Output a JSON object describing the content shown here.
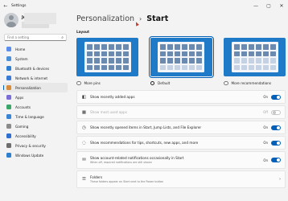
{
  "window": {
    "title": "Settings",
    "back": "←",
    "minimize": "—",
    "maximize": "▢",
    "close": "✕"
  },
  "user": {
    "name": "Jeff"
  },
  "search": {
    "placeholder": "Find a setting",
    "icon": "search-icon"
  },
  "nav": [
    {
      "label": "Home",
      "name": "home",
      "color": "#5b8def"
    },
    {
      "label": "System",
      "name": "system",
      "color": "#4a90d9"
    },
    {
      "label": "Bluetooth & devices",
      "name": "bluetooth",
      "color": "#2f7fd1"
    },
    {
      "label": "Network & internet",
      "name": "network",
      "color": "#3a7bd5"
    },
    {
      "label": "Personalization",
      "name": "personalization",
      "color": "#d98c3a",
      "active": true
    },
    {
      "label": "Apps",
      "name": "apps",
      "color": "#7a6fd8"
    },
    {
      "label": "Accounts",
      "name": "accounts",
      "color": "#3aa66a"
    },
    {
      "label": "Time & language",
      "name": "time-language",
      "color": "#3a84d8"
    },
    {
      "label": "Gaming",
      "name": "gaming",
      "color": "#8a8a8a"
    },
    {
      "label": "Accessibility",
      "name": "accessibility",
      "color": "#2f6fd0"
    },
    {
      "label": "Privacy & security",
      "name": "privacy",
      "color": "#6d6d6d"
    },
    {
      "label": "Windows Update",
      "name": "windows-update",
      "color": "#2f7fd1"
    }
  ],
  "header": {
    "crumb": "Personalization",
    "separator": "›",
    "page": "Start"
  },
  "layout": {
    "label": "Layout",
    "options": [
      {
        "label": "More pins",
        "selected": false
      },
      {
        "label": "Default",
        "selected": true
      },
      {
        "label": "More recommendations",
        "selected": false
      }
    ]
  },
  "settings": [
    {
      "icon": "◧",
      "label": "Show recently added apps",
      "state": "On",
      "on": true,
      "enabled": true
    },
    {
      "icon": "▦",
      "label": "Show most used apps",
      "state": "Off",
      "on": false,
      "enabled": false
    },
    {
      "icon": "◷",
      "label": "Show recently opened items in Start, Jump Lists, and File Explorer",
      "state": "On",
      "on": true,
      "enabled": true
    },
    {
      "icon": "◌",
      "label": "Show recommendations for tips, shortcuts, new apps, and more",
      "state": "On",
      "on": true,
      "enabled": true
    },
    {
      "icon": "✉",
      "label": "Show account-related notifications occasionally in Start",
      "sub": "When off, required notifications are still shown",
      "state": "On",
      "on": true,
      "enabled": true,
      "tall": true
    },
    {
      "icon": "☰",
      "label": "Folders",
      "sub": "These folders appear on Start next to the Power button",
      "chevron": "›",
      "tall": true
    }
  ]
}
